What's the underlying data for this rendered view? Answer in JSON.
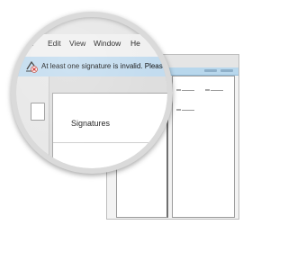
{
  "menu": {
    "items": [
      {
        "label": "e"
      },
      {
        "label": "Edit"
      },
      {
        "label": "View"
      },
      {
        "label": "Window"
      },
      {
        "label": "He"
      }
    ]
  },
  "infobar": {
    "message": "At least one signature is invalid.  Please",
    "icon": "invalid-signature-warning-icon",
    "background_color": "#c3dcef"
  },
  "signatures_panel": {
    "title": "Signatures"
  }
}
